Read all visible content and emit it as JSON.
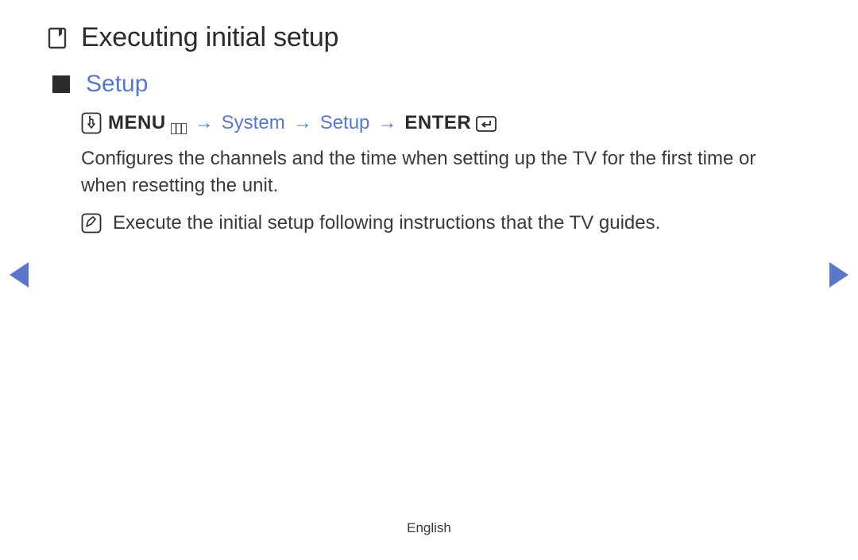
{
  "header": {
    "title": "Executing initial setup"
  },
  "section": {
    "title": "Setup"
  },
  "breadcrumb": {
    "menu_label": "MENU",
    "arrow": "→",
    "system_label": "System",
    "setup_label": "Setup",
    "enter_label": "ENTER"
  },
  "body": {
    "paragraph": "Configures the channels and the time when setting up the TV for the first time or when resetting the unit.",
    "note": "Execute the initial setup following instructions that the TV guides."
  },
  "footer": {
    "language": "English"
  },
  "icons": {
    "bookmark": "bookmark-icon",
    "square": "square-bullet-icon",
    "hand": "hand-pointer-icon",
    "menu_bars": "menu-bars-icon",
    "enter_key": "enter-key-icon",
    "note": "note-pencil-icon",
    "prev": "prev-arrow-icon",
    "next": "next-arrow-icon"
  }
}
